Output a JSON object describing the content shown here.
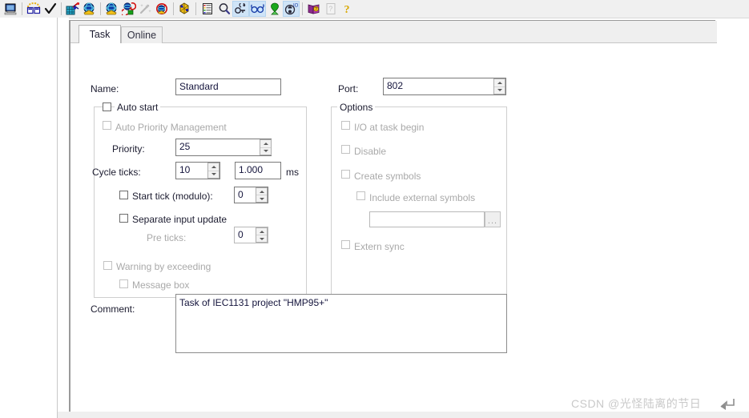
{
  "toolbar": {
    "items": [
      {
        "name": "save-monitor-icon",
        "group": 0,
        "active": false
      },
      {
        "name": "compare-windows-icon",
        "group": 1,
        "active": false
      },
      {
        "name": "check-mark-icon",
        "group": 1,
        "active": false
      },
      {
        "name": "build-project-icon",
        "group": 2,
        "active": false
      },
      {
        "name": "activate-config-icon",
        "group": 2,
        "active": false
      },
      {
        "name": "globe-blue-icon",
        "group": 3,
        "active": false
      },
      {
        "name": "reload-devices-icon",
        "group": 3,
        "active": false
      },
      {
        "name": "magic-wand-icon",
        "group": 3,
        "active": false
      },
      {
        "name": "restart-target-icon",
        "group": 3,
        "active": false
      },
      {
        "name": "link-variables-icon",
        "group": 4,
        "active": false
      },
      {
        "name": "logger-list-icon",
        "group": 5,
        "active": false
      },
      {
        "name": "search-magnifier-icon",
        "group": 5,
        "active": false
      },
      {
        "name": "toggle-free-run-icon",
        "group": 5,
        "active": true
      },
      {
        "name": "watch-glasses-icon",
        "group": 6,
        "active": true
      },
      {
        "name": "pin-green-icon",
        "group": 6,
        "active": false
      },
      {
        "name": "login-user-icon",
        "group": 6,
        "active": true
      },
      {
        "name": "help-book-icon",
        "group": 7,
        "active": false
      },
      {
        "name": "help-page-icon",
        "group": 7,
        "active": false
      },
      {
        "name": "help-question-icon",
        "group": 7,
        "active": false
      }
    ]
  },
  "tabs": [
    {
      "id": "task",
      "label": "Task",
      "active": true
    },
    {
      "id": "online",
      "label": "Online",
      "active": false
    }
  ],
  "form": {
    "name_label": "Name:",
    "name_value": "Standard",
    "port_label": "Port:",
    "port_value": "802",
    "auto_start_label": "Auto start",
    "auto_priority_label": "Auto Priority Management",
    "priority_label": "Priority:",
    "priority_value": "25",
    "cycle_ticks_label": "Cycle ticks:",
    "cycle_ticks_value": "10",
    "cycle_time_value": "1.000",
    "cycle_time_unit": "ms",
    "start_tick_label": "Start tick (modulo):",
    "start_tick_value": "0",
    "separate_input_label": "Separate input update",
    "pre_ticks_label": "Pre ticks:",
    "pre_ticks_value": "0",
    "warning_exceeding_label": "Warning by exceeding",
    "message_box_label": "Message box",
    "options_group_label": "Options",
    "io_at_task_begin_label": "I/O at task begin",
    "disable_label": "Disable",
    "create_symbols_label": "Create symbols",
    "include_external_label": "Include external symbols",
    "symbols_path_value": "",
    "browse_label": "...",
    "extern_sync_label": "Extern sync",
    "comment_label": "Comment:",
    "comment_value": "Task of IEC1131 project \"HMP95+\""
  },
  "watermark": {
    "text": "CSDN @光怪陆离的节日"
  },
  "colors": {
    "toolbar_bg": "#f0f0f0",
    "tab_active_bg": "#ffffff",
    "tabstrip_bg": "#efefef",
    "active_tool_bg": "#cfe4f7",
    "text": "#1b1b2f",
    "dim_text": "#a9a9a9",
    "field_value": "#14143c"
  }
}
